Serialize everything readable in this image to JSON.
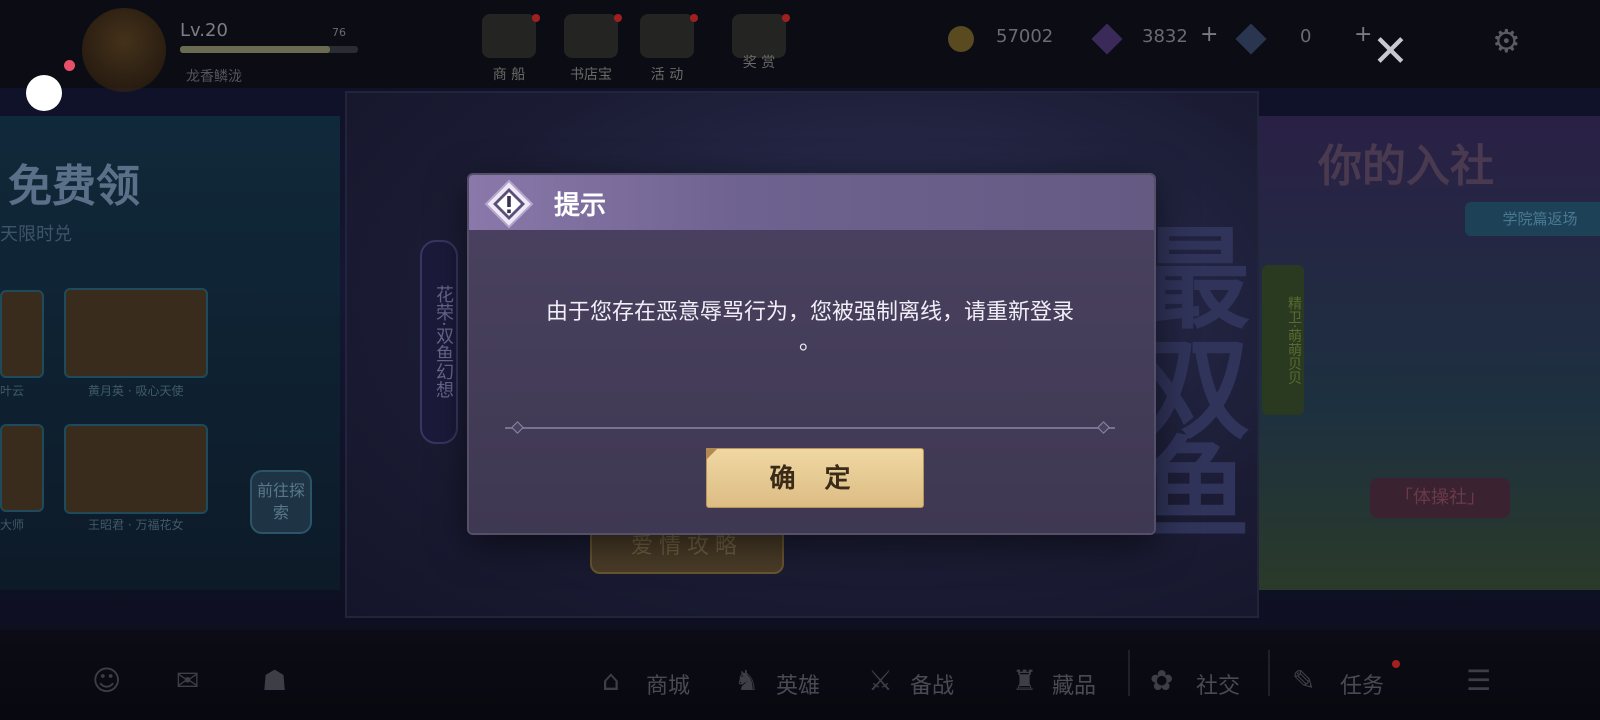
{
  "top": {
    "level": "Lv.20",
    "xp_text": "76",
    "username": "龙香鳞泷",
    "icons": [
      {
        "name": "shop",
        "label": "商 船"
      },
      {
        "name": "bookshop",
        "label": "书店宝"
      },
      {
        "name": "events",
        "label": "活 动"
      },
      {
        "name": "prize",
        "label": "奖 赏"
      }
    ],
    "coins": "57002",
    "gems": "3832",
    "crystals": "0"
  },
  "background": {
    "left_title": "免费领",
    "left_sub": "天限时兑",
    "cards": [
      "叶云",
      "黄月英 · 吸心天使",
      "大师",
      "王昭君 · 万福花女"
    ],
    "go_explore": "前往探索",
    "vertical_banner": "花荣·双鱼幻想",
    "big_chars": [
      "最",
      "双",
      "鱼"
    ],
    "love_button": "爱情攻略",
    "right_title": "你的入社",
    "right_banner": "学院篇返场",
    "right_side": "精卫·萌萌贝贝",
    "right_club": "「体操社」"
  },
  "bottom_nav": [
    {
      "icon": "shop-icon",
      "label": "商城"
    },
    {
      "icon": "hero-icon",
      "label": "英雄"
    },
    {
      "icon": "battle-icon",
      "label": "备战"
    },
    {
      "icon": "collection-icon",
      "label": "藏品"
    },
    {
      "icon": "social-icon",
      "label": "社交"
    },
    {
      "icon": "task-icon",
      "label": "任务"
    }
  ],
  "dialog": {
    "title": "提示",
    "message_line1": "由于您存在恶意辱骂行为，您被强制离线，请重新登录",
    "message_line2": "。",
    "confirm_label": "确 定"
  }
}
